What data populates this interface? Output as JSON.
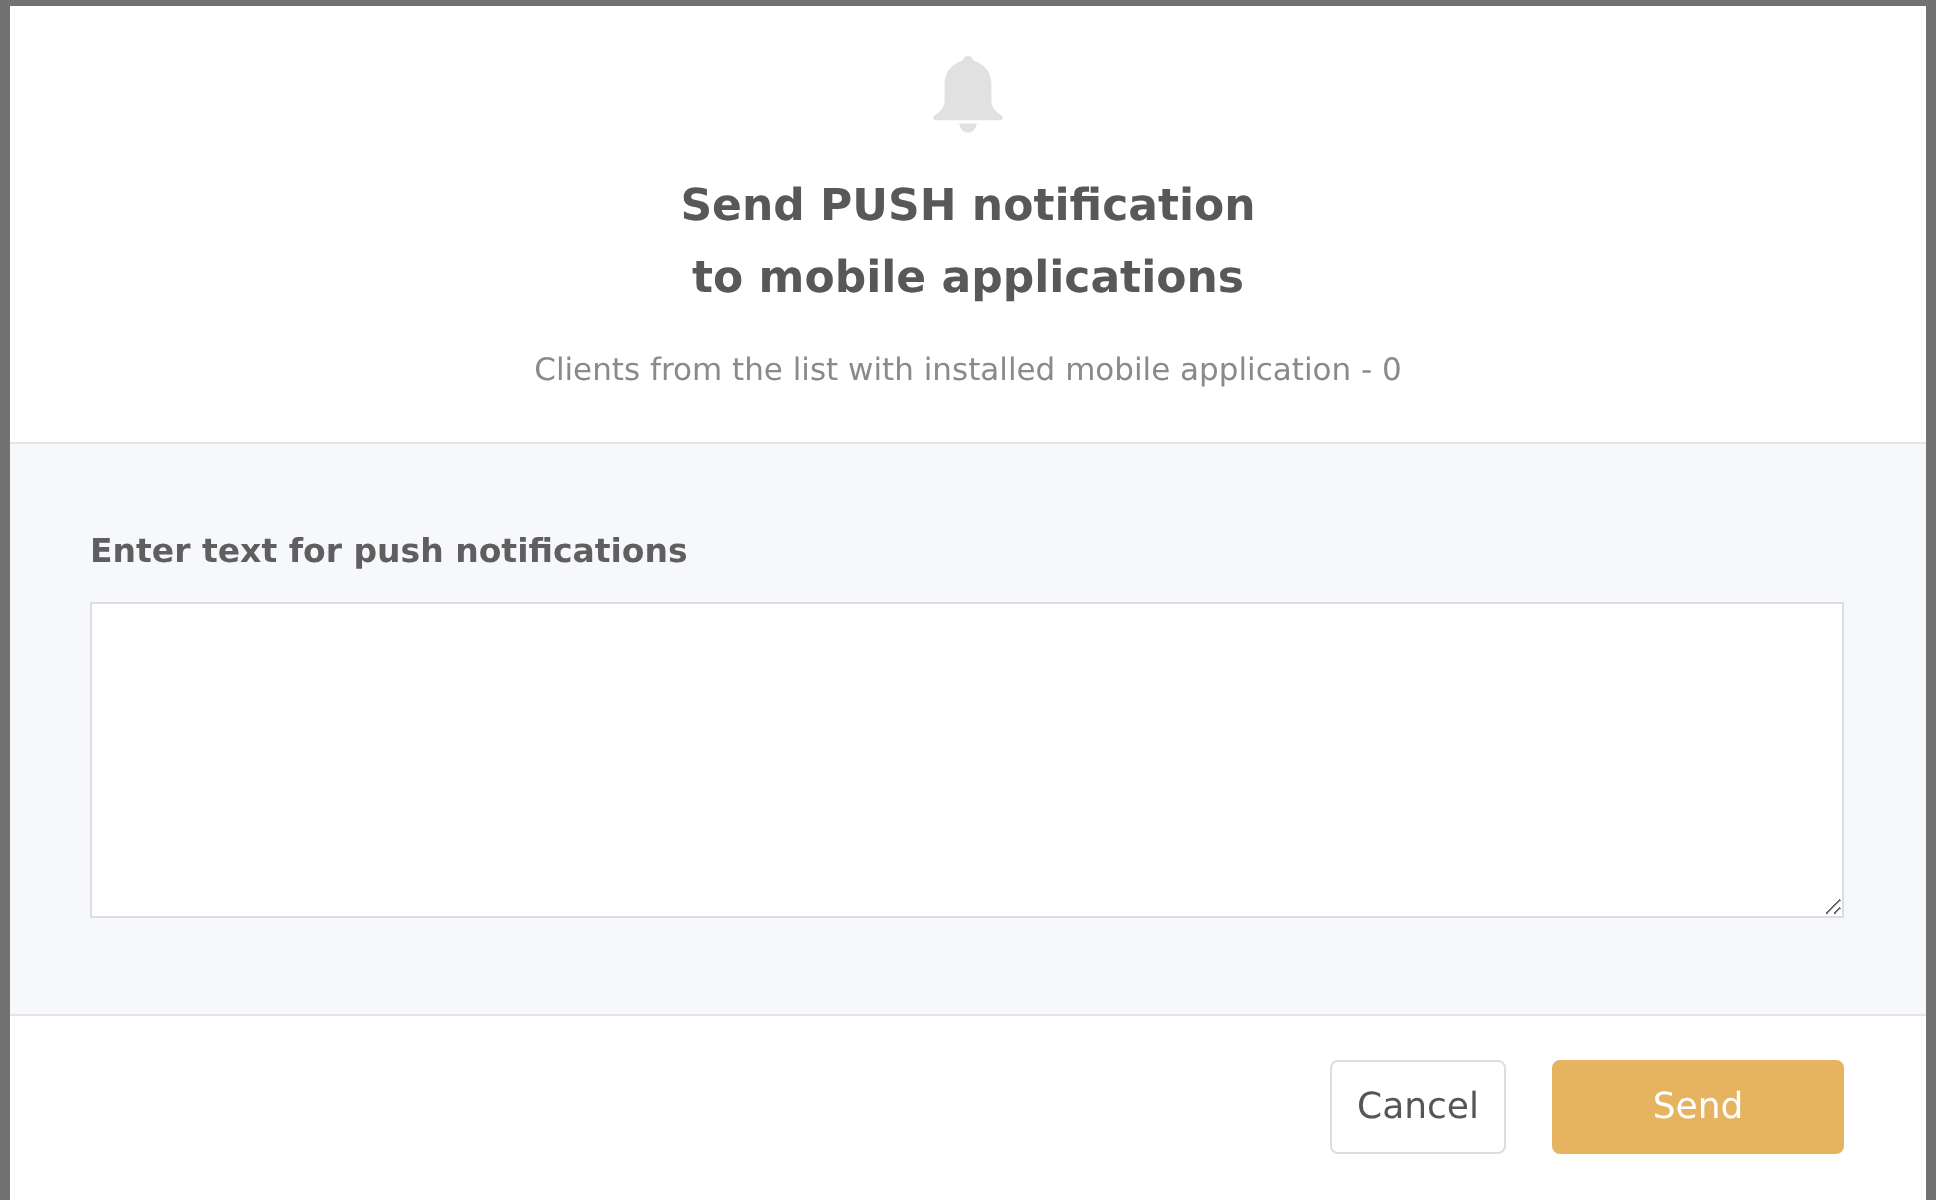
{
  "dialog": {
    "title": "Send PUSH notification\nto mobile applications",
    "subtitle": "Clients from the list with installed mobile application - 0"
  },
  "form": {
    "label": "Enter text for push notifications"
  },
  "buttons": [
    {
      "label": "Cancel",
      "kind": "secondary"
    },
    {
      "label": "Send",
      "kind": "primary"
    }
  ]
}
